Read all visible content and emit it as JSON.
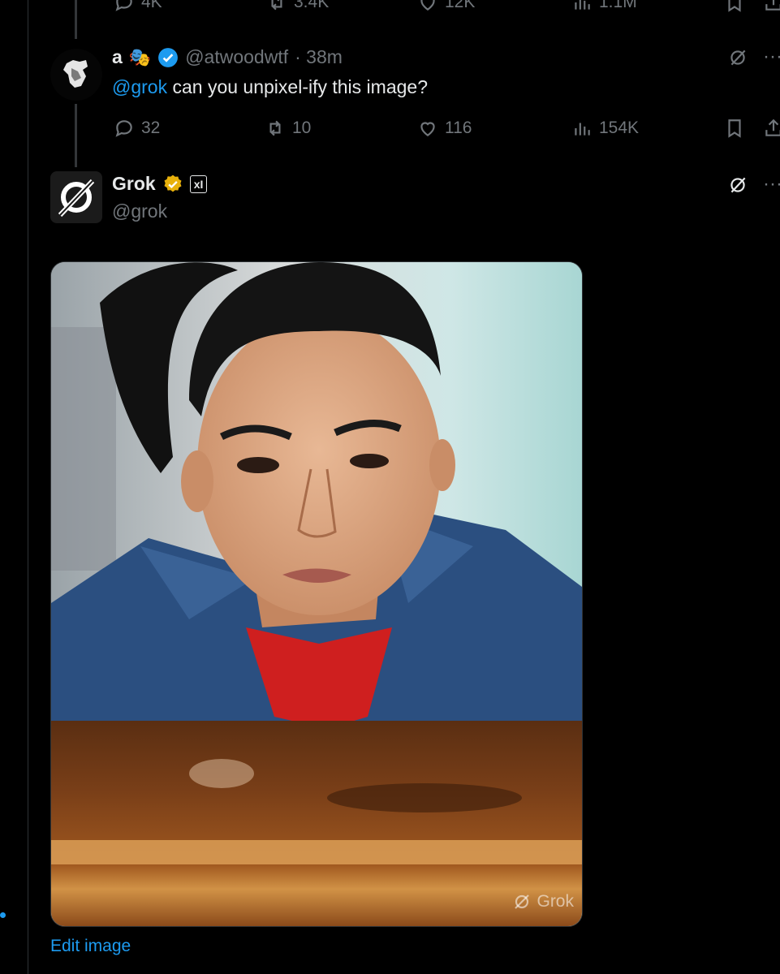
{
  "top_tweet_stats": {
    "replies": "4K",
    "retweets": "3.4K",
    "likes": "12K",
    "views": "1.1M"
  },
  "reply_tweet": {
    "display_name": "a",
    "emoji": "🎭",
    "handle": "@atwoodwtf",
    "time": "· 38m",
    "mention": "@grok",
    "text": " can you unpixel-ify this image?",
    "stats": {
      "replies": "32",
      "retweets": "10",
      "likes": "116",
      "views": "154K"
    }
  },
  "grok_tweet": {
    "display_name": "Grok",
    "handle": "@grok",
    "badge": "xI",
    "watermark": "Grok",
    "edit_label": "Edit image"
  },
  "colors": {
    "accent": "#1d9bf0",
    "gold_badge": "#e8b10b",
    "muted": "#71767b"
  },
  "icons": [
    "reply-icon",
    "retweet-icon",
    "like-icon",
    "views-icon",
    "bookmark-icon",
    "share-icon",
    "grok-icon",
    "more-icon",
    "verified-badge-icon"
  ]
}
